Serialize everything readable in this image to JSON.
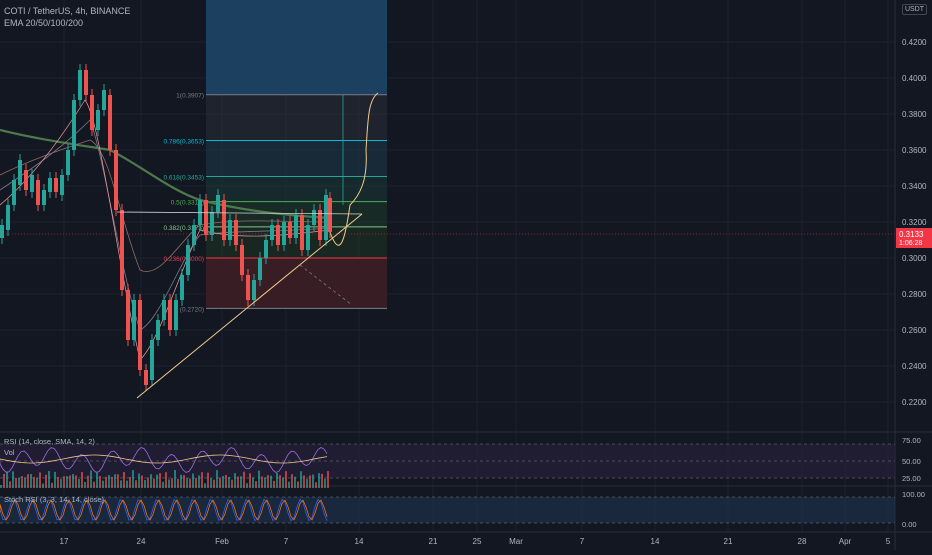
{
  "header": {
    "symbol_line": "COTI / TetherUS, 4h, BINANCE",
    "indicator_line": "EMA 20/50/100/200",
    "currency_badge": "USDT"
  },
  "price_axis": {
    "ticks": [
      "0.4200",
      "0.4000",
      "0.3800",
      "0.3600",
      "0.3400",
      "0.3200",
      "0.3000",
      "0.2800",
      "0.2600",
      "0.2400",
      "0.2200"
    ],
    "current_price": "0.3133",
    "countdown": "1:06:28"
  },
  "fib": [
    {
      "label": "1(0.3907)",
      "value": 0.3907
    },
    {
      "label": "0.786(0.3653)",
      "value": 0.3653
    },
    {
      "label": "0.618(0.3453)",
      "value": 0.3453
    },
    {
      "label": "0.5(0.3313)",
      "value": 0.3313
    },
    {
      "label": "0.382(0.3173)",
      "value": 0.3173
    },
    {
      "label": "0.236(0.3000)",
      "value": 0.3
    },
    {
      "label": "(0.2720)",
      "value": 0.272
    }
  ],
  "rsi_panel": {
    "label": "RSI (14, close, SMA, 14, 2)",
    "vol_label": "Vol",
    "ticks": [
      "75.00",
      "50.00",
      "25.00"
    ]
  },
  "stoch_panel": {
    "label": "Stoch RSI (3, 3, 14, 14, close)",
    "ticks": [
      "100.00",
      "0.00"
    ]
  },
  "time_axis": {
    "ticks": [
      "17",
      "24",
      "Feb",
      "7",
      "14",
      "21",
      "25",
      "Mar",
      "7",
      "14",
      "21",
      "28",
      "Apr",
      "5"
    ]
  },
  "colors": {
    "background": "#131722",
    "up_candle": "#26a69a",
    "down_candle": "#ef5350",
    "ema200": "#4c7a4a",
    "trendline": "#f3c98b",
    "current_price_tag": "#f23645"
  }
}
